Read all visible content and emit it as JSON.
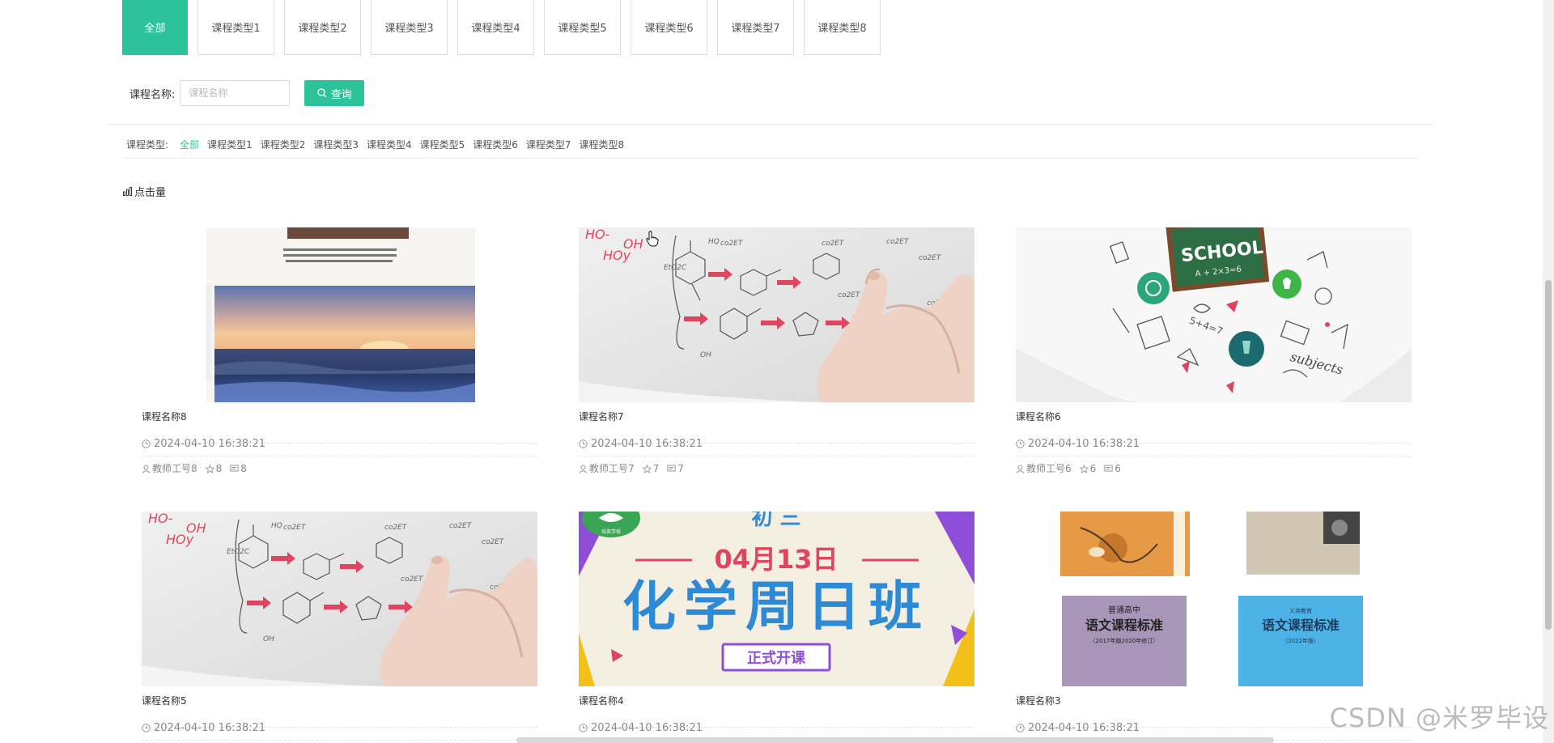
{
  "tabs": [
    {
      "label": "全部",
      "active": true
    },
    {
      "label": "课程类型1",
      "active": false
    },
    {
      "label": "课程类型2",
      "active": false
    },
    {
      "label": "课程类型3",
      "active": false
    },
    {
      "label": "课程类型4",
      "active": false
    },
    {
      "label": "课程类型5",
      "active": false
    },
    {
      "label": "课程类型6",
      "active": false
    },
    {
      "label": "课程类型7",
      "active": false
    },
    {
      "label": "课程类型8",
      "active": false
    }
  ],
  "search": {
    "label": "课程名称:",
    "placeholder": "课程名称",
    "value": "",
    "button_label": "查询"
  },
  "filter": {
    "label": "课程类型:",
    "items": [
      {
        "label": "全部",
        "active": true
      },
      {
        "label": "课程类型1",
        "active": false
      },
      {
        "label": "课程类型2",
        "active": false
      },
      {
        "label": "课程类型3",
        "active": false
      },
      {
        "label": "课程类型4",
        "active": false
      },
      {
        "label": "课程类型5",
        "active": false
      },
      {
        "label": "课程类型6",
        "active": false
      },
      {
        "label": "课程类型7",
        "active": false
      },
      {
        "label": "课程类型8",
        "active": false
      }
    ]
  },
  "sort": {
    "icon": "bar-chart-icon",
    "label": "点击量"
  },
  "cards": [
    {
      "title": "课程名称8",
      "date": "2024-04-10 16:38:21",
      "teacher": "教师工号8",
      "stars": "8",
      "comments": "8",
      "image": "textbook-sunset-cover"
    },
    {
      "title": "课程名称7",
      "date": "2024-04-10 16:38:21",
      "teacher": "教师工号7",
      "stars": "7",
      "comments": "7",
      "image": "chemistry-hand-drawing"
    },
    {
      "title": "课程名称6",
      "date": "2024-04-10 16:38:21",
      "teacher": "教师工号6",
      "stars": "6",
      "comments": "6",
      "image": "school-subjects-illustration"
    },
    {
      "title": "课程名称5",
      "date": "2024-04-10 16:38:21",
      "image": "chemistry-hand-drawing"
    },
    {
      "title": "课程名称4",
      "date": "2024-04-10 16:38:21",
      "image": "chemistry-sunday-class-poster",
      "poster": {
        "line1": "初 三",
        "line2": "04月13日",
        "line3": "化学周日班",
        "line4": "正式开课"
      }
    },
    {
      "title": "课程名称3",
      "date": "2024-04-10 16:38:21",
      "image": "chinese-curriculum-books",
      "books": {
        "b1": "普通高中",
        "b2": "语文课程标准",
        "b3": "语文课程标准"
      }
    }
  ],
  "watermark": "CSDN @米罗毕设",
  "colors": {
    "accent": "#2cc39a",
    "text": "#333333",
    "muted": "#888888",
    "border": "#dcdcdc"
  }
}
